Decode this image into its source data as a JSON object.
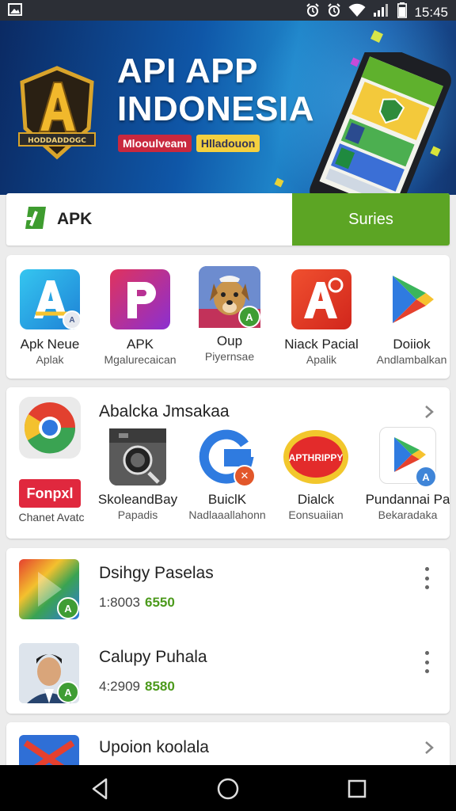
{
  "status_bar": {
    "time": "15:45"
  },
  "banner": {
    "title_line1": "API APP",
    "title_line2": "INDONESIA",
    "tag_red": "Mlooulvеam",
    "tag_yellow": "Hlladouon",
    "logo_letter": "A",
    "logo_ribbon": "HODDADDOGC"
  },
  "tabs": {
    "apk_label": "APK",
    "series_label": "Suries"
  },
  "featured_apps": [
    {
      "name": "Apk Neue",
      "sub": "Aplak"
    },
    {
      "name": "APK",
      "sub": "Mgalurecaican"
    },
    {
      "name": "Oup",
      "sub": "Piyernsae"
    },
    {
      "name": "Niack Pacial",
      "sub": "Apalik"
    },
    {
      "name": "Doiiok",
      "sub": "Andlambalkan"
    }
  ],
  "section2": {
    "title": "Abalcka Jmsakaa",
    "side_logo": "Fonpxl",
    "side_label": "Chanet Avatc",
    "apps": [
      {
        "name": "SkoleandBay",
        "sub": "Papadis"
      },
      {
        "name": "BuiclK",
        "sub": "Nadlaaallahonn"
      },
      {
        "name": "Dialck",
        "sub": "Eonsuaiian",
        "logo_text": "APTHRIPPY"
      },
      {
        "name": "Pundannai Pa",
        "sub": "Bekaradaka"
      }
    ]
  },
  "list_items": [
    {
      "title": "Dsihgy Paselas",
      "meta": "1:8003",
      "score": "6550"
    },
    {
      "title": "Calupy Puhala",
      "meta": "4:2909",
      "score": "8580"
    }
  ],
  "partial_item": {
    "title": "Upoion koolala"
  },
  "icons": [
    "gallery-icon",
    "alarm-icon",
    "alarm-icon",
    "wifi-icon",
    "signal-icon",
    "battery-icon",
    "chevron-right-icon",
    "more-vert-icon",
    "back-icon",
    "home-icon",
    "recents-icon"
  ],
  "colors": {
    "accent_green": "#5ca524",
    "banner_blue": "#0f57a8",
    "score_green": "#4c9a1c"
  }
}
